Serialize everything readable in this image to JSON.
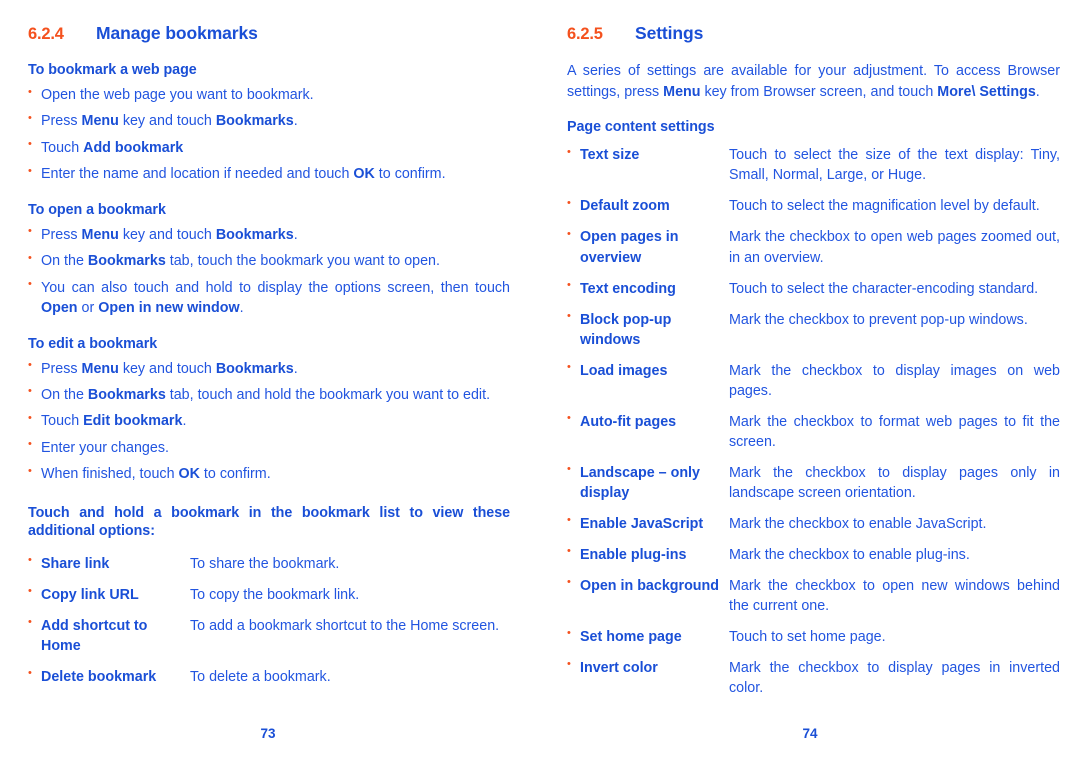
{
  "document": {
    "bullet_glyph": "•",
    "colors": {
      "heading_blue": "#1a4fd6",
      "body_blue": "#2255e0",
      "accent_orange": "#f4511e",
      "background": "#ffffff"
    }
  },
  "left_page": {
    "page_number": "73",
    "section": {
      "number": "6.2.4",
      "title": "Manage bookmarks"
    },
    "groups": [
      {
        "heading": "To bookmark a web page",
        "items": [
          {
            "html": "Open the web page you want to bookmark."
          },
          {
            "html": "Press <b>Menu</b> key and touch <b>Bookmarks</b>."
          },
          {
            "html": "Touch <b>Add bookmark</b>"
          },
          {
            "html": "Enter the name and location if needed and touch <b>OK</b> to confirm."
          }
        ]
      },
      {
        "heading": "To open a bookmark",
        "items": [
          {
            "html": "Press <b>Menu</b> key and touch <b>Bookmarks</b>."
          },
          {
            "html": "On the <b>Bookmarks</b> tab, touch the bookmark you want to open."
          },
          {
            "html": "You can also touch and hold to display the options screen, then touch <b>Open</b> or <b>Open in new window</b>."
          }
        ]
      },
      {
        "heading": "To edit a bookmark",
        "items": [
          {
            "html": "Press <b>Menu</b> key and touch <b>Bookmarks</b>."
          },
          {
            "html": "On the <b>Bookmarks</b> tab, touch and hold the bookmark you want to edit."
          },
          {
            "html": "Touch <b>Edit bookmark</b>."
          },
          {
            "html": "Enter your changes."
          },
          {
            "html": "When finished, touch <b>OK</b> to confirm."
          }
        ]
      }
    ],
    "options_intro": "Touch and hold a bookmark in the bookmark list to view these additional options:",
    "options": [
      {
        "term": "Share link",
        "desc": "To share the bookmark."
      },
      {
        "term": "Copy link URL",
        "desc": "To copy the bookmark link."
      },
      {
        "term": "Add shortcut to Home",
        "desc": "To add a bookmark shortcut to the Home screen."
      },
      {
        "term": "Delete bookmark",
        "desc": "To delete a bookmark."
      }
    ]
  },
  "right_page": {
    "page_number": "74",
    "section": {
      "number": "6.2.5",
      "title": "Settings"
    },
    "intro_html": "A series of settings are available for your adjustment. To access Browser settings, press <b>Menu</b> key from Browser screen, and touch <b>More\\ Settings</b>.",
    "subheading": "Page content settings",
    "settings": [
      {
        "term": "Text size",
        "desc": "Touch to select the size of the text display: Tiny, Small, Normal, Large, or Huge."
      },
      {
        "term": "Default zoom",
        "desc": "Touch to select the magnification level by default."
      },
      {
        "term": "Open pages in overview",
        "desc": "Mark the checkbox to open web pages zoomed out, in an overview."
      },
      {
        "term": "Text encoding",
        "desc": "Touch to select the character-encoding standard."
      },
      {
        "term": "Block pop-up windows",
        "desc": "Mark the checkbox to prevent pop-up windows."
      },
      {
        "term": "Load images",
        "desc": "Mark the checkbox to display images on web pages."
      },
      {
        "term": "Auto-fit pages",
        "desc": "Mark the checkbox to format web pages to fit the screen."
      },
      {
        "term": "Landscape – only display",
        "desc": "Mark the checkbox to display pages only in landscape screen orientation."
      },
      {
        "term": "Enable JavaScript",
        "desc": "Mark the checkbox to enable JavaScript."
      },
      {
        "term": "Enable plug-ins",
        "desc": "Mark the checkbox to enable plug-ins."
      },
      {
        "term": "Open in background",
        "desc": "Mark the checkbox to open new windows behind the current one."
      },
      {
        "term": "Set home page",
        "desc": "Touch to set home page."
      },
      {
        "term": "Invert color",
        "desc": "Mark the checkbox to display pages in inverted color."
      }
    ]
  }
}
